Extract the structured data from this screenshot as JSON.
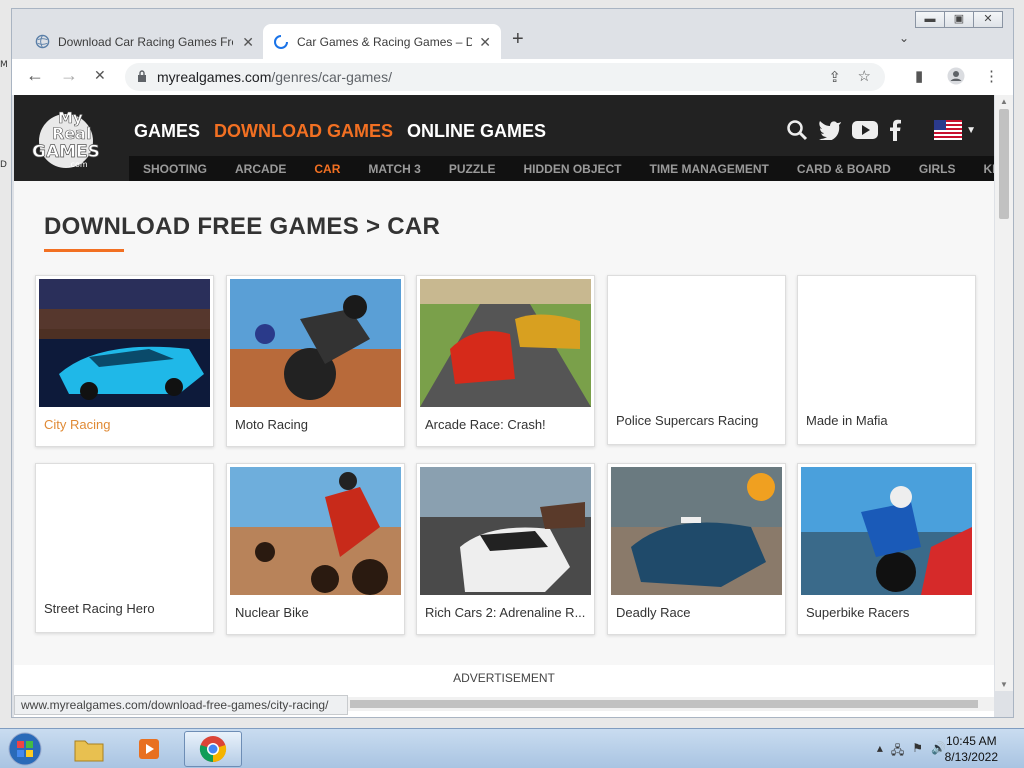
{
  "browser": {
    "tabs": [
      {
        "title": "Download Car Racing Games Fre"
      },
      {
        "title": "Car Games & Racing Games – Do"
      }
    ],
    "url_host": "myrealgames.com",
    "url_path": "/genres/car-games/",
    "status_url": "www.myrealgames.com/download-free-games/city-racing/"
  },
  "site": {
    "logo_text": [
      "My",
      "Real",
      "GAMES",
      ".com"
    ],
    "main_nav": [
      "GAMES",
      "DOWNLOAD GAMES",
      "ONLINE GAMES"
    ],
    "sub_nav": [
      "SHOOTING",
      "ARCADE",
      "CAR",
      "MATCH 3",
      "PUZZLE",
      "HIDDEN OBJECT",
      "TIME MANAGEMENT",
      "CARD & BOARD",
      "GIRLS",
      "KIDS"
    ],
    "accent_color": "#f27022"
  },
  "page": {
    "title": "DOWNLOAD FREE GAMES > CAR",
    "games": [
      {
        "name": "City Racing"
      },
      {
        "name": "Moto Racing"
      },
      {
        "name": "Arcade Race: Crash!"
      },
      {
        "name": "Police Supercars Racing"
      },
      {
        "name": "Made in Mafia"
      },
      {
        "name": "Street Racing Hero"
      },
      {
        "name": "Nuclear Bike"
      },
      {
        "name": "Rich Cars 2: Adrenaline R..."
      },
      {
        "name": "Deadly Race"
      },
      {
        "name": "Superbike Racers"
      }
    ],
    "ad_label": "ADVERTISEMENT"
  },
  "taskbar": {
    "time": "10:45 AM",
    "date": "8/13/2022"
  }
}
